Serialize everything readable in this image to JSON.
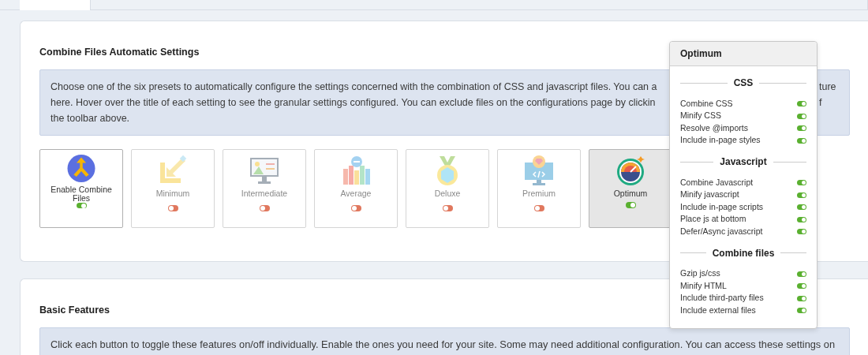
{
  "tabs": [
    {
      "selected": true
    },
    {
      "selected": false
    }
  ],
  "combine_card": {
    "title": "Combine Files Automatic Settings",
    "info_lines": [
      {
        "text": "Choose one of the six presets to automatically configure the settings concerned with the combination of CSS and javascript files. You can a",
        "tail": "ture"
      },
      {
        "text": "here. Hover over the title of each setting to see the granular settings configured. You can exclude files on the configurations page by clickin",
        "tail": "f"
      },
      {
        "text": "the toolbar above."
      }
    ],
    "presets": [
      {
        "label": "Enable Combine Files",
        "kind": "switch",
        "on": true,
        "selected": false
      },
      {
        "label": "Minimum",
        "kind": "preset",
        "on": false,
        "selected": false
      },
      {
        "label": "Intermediate",
        "kind": "preset",
        "on": false,
        "selected": false
      },
      {
        "label": "Average",
        "kind": "preset",
        "on": false,
        "selected": false
      },
      {
        "label": "Deluxe",
        "kind": "preset",
        "on": false,
        "selected": false
      },
      {
        "label": "Premium",
        "kind": "preset",
        "on": false,
        "selected": false
      },
      {
        "label": "Optimum",
        "kind": "preset",
        "on": true,
        "selected": true
      }
    ]
  },
  "popover": {
    "title": "Optimum",
    "sections": [
      {
        "title": "CSS",
        "items": [
          {
            "label": "Combine CSS",
            "on": true
          },
          {
            "label": "Minify CSS",
            "on": true
          },
          {
            "label": "Resolve @imports",
            "on": true
          },
          {
            "label": "Include in-page styles",
            "on": true
          }
        ]
      },
      {
        "title": "Javascript",
        "items": [
          {
            "label": "Combine Javascript",
            "on": true
          },
          {
            "label": "Minify javascript",
            "on": true
          },
          {
            "label": "Include in-page scripts",
            "on": true
          },
          {
            "label": "Place js at bottom",
            "on": true
          },
          {
            "label": "Defer/Async javascript",
            "on": true
          }
        ]
      },
      {
        "title": "Combine files",
        "items": [
          {
            "label": "Gzip js/css",
            "on": true
          },
          {
            "label": "Minify HTML",
            "on": true
          },
          {
            "label": "Include third-party files",
            "on": true
          },
          {
            "label": "Include external files",
            "on": true
          }
        ]
      }
    ]
  },
  "features_card": {
    "title": "Basic Features",
    "info": "Click each button to toggle these features on/off individually. Enable the ones you need for your site. Some may need additional configuration. You can access these settings on"
  }
}
